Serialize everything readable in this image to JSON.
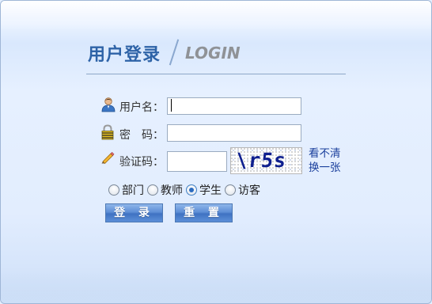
{
  "header": {
    "title_cn": "用户登录",
    "title_en": "LOGIN"
  },
  "form": {
    "username": {
      "label": "用户名：",
      "value": ""
    },
    "password": {
      "label": "密　码：",
      "value": ""
    },
    "captcha": {
      "label": "验证码：",
      "value": "",
      "image_text": "\\r5s"
    },
    "refresh": {
      "line1": "看不清",
      "line2": "换一张"
    }
  },
  "roles": {
    "options": [
      "部门",
      "教师",
      "学生",
      "访客"
    ],
    "selected": "学生"
  },
  "buttons": {
    "login": "登 录",
    "reset": "重 置"
  },
  "colors": {
    "title": "#2e63a7",
    "link": "#1a3f9c",
    "button": "#5e8fd6"
  },
  "icons": {
    "username": "user-icon",
    "password": "lock-icon",
    "captcha": "pencil-icon"
  }
}
